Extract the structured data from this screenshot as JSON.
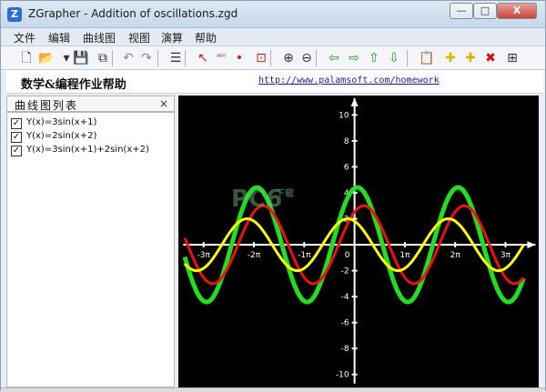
{
  "window": {
    "title": "ZGrapher - Addition of oscillations.zgd",
    "app_icon": "Z",
    "controls": {
      "minimize": "—",
      "maximize": "□",
      "close": "X"
    }
  },
  "menu": [
    "文件",
    "编辑",
    "曲线图",
    "视图",
    "演算",
    "帮助"
  ],
  "toolbar": {
    "icons": [
      "new-file-icon",
      "open-folder-icon",
      "dropdown-arrow-icon",
      "save-icon",
      "copy-icon",
      "undo-icon",
      "redo-icon",
      "curve-list-icon",
      "pointer-icon",
      "label-icon",
      "point-icon",
      "zoom-box-icon",
      "zoom-in-icon",
      "zoom-out-icon",
      "arrow-left-icon",
      "arrow-right-icon",
      "arrow-up-icon",
      "arrow-down-icon",
      "clipboard-icon",
      "add-curve-icon",
      "add-curve-alt-icon",
      "delete-icon",
      "properties-icon"
    ],
    "glyphs": [
      "🗋",
      "📂",
      "▾",
      "💾",
      "⧉",
      "↶",
      "↷",
      "☰",
      "↖",
      "ᵃᵇˡ",
      "•",
      "⊡",
      "⊕",
      "⊖",
      "⇦",
      "⇨",
      "⇧",
      "⇩",
      "📋",
      "✚",
      "✚",
      "✖",
      "⊞"
    ]
  },
  "banner": {
    "title": "数学&编程作业帮助",
    "link": "http://www.palamsoft.com/homework"
  },
  "curves_panel": {
    "title": "曲线图列表",
    "close": "×",
    "items": [
      {
        "label": "Y(x)=3sin(x+1)",
        "checked": true,
        "color": "#ff1010"
      },
      {
        "label": "Y(x)=2sin(x+2)",
        "checked": true,
        "color": "#ffff00"
      },
      {
        "label": "Y(x)=3sin(x+1)+2sin(x+2)",
        "checked": true,
        "color": "#22dd22"
      }
    ]
  },
  "watermark": {
    "text": "PC6",
    "sub": "下载"
  },
  "chart_data": {
    "type": "line",
    "xlim": [
      -11.0,
      11.5
    ],
    "ylim": [
      -11.0,
      11.5
    ],
    "x_tick_labels": [
      "-3π",
      "-2π",
      "-1π",
      "0",
      "1π",
      "2π",
      "3π"
    ],
    "x_tick_values": [
      -9.4248,
      -6.2832,
      -3.1416,
      0,
      3.1416,
      6.2832,
      9.4248
    ],
    "y_tick_labels": [
      "10",
      "8",
      "6",
      "4",
      "2",
      "-2",
      "-4",
      "-6",
      "-8",
      "-10"
    ],
    "y_tick_values": [
      10,
      8,
      6,
      4,
      2,
      -2,
      -4,
      -6,
      -8,
      -10
    ],
    "series": [
      {
        "name": "Y(x)=3sin(x+1)",
        "color": "#ee1111",
        "amplitude": 3,
        "phase": 1
      },
      {
        "name": "Y(x)=2sin(x+2)",
        "color": "#ffff00",
        "amplitude": 2,
        "phase": 2
      },
      {
        "name": "Y(x)=3sin(x+1)+2sin(x+2)",
        "color": "#22dd22",
        "combined": true
      }
    ],
    "background": "#000000",
    "axis_color": "#ffffff"
  }
}
